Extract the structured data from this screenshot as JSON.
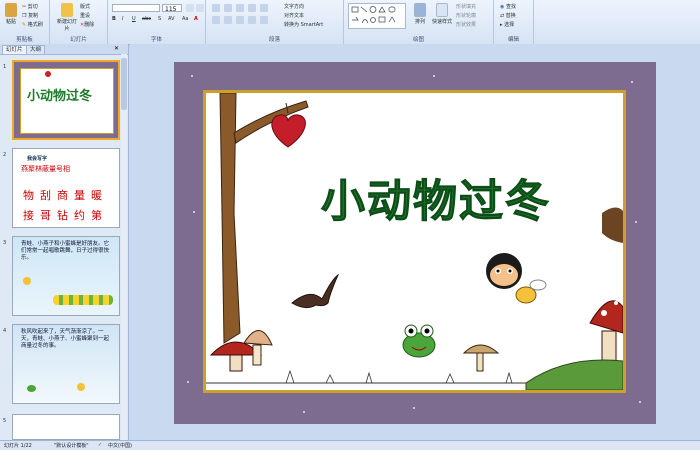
{
  "ribbon": {
    "clipboard": {
      "paste": "粘贴",
      "cut": "剪切",
      "copy": "复制",
      "format_painter": "格式刷",
      "label": "剪贴板"
    },
    "slides": {
      "new_slide": "新建幻灯片",
      "layout": "版式",
      "reset": "重设",
      "delete": "删除",
      "label": "幻灯片"
    },
    "font": {
      "size": "115",
      "label": "字体"
    },
    "paragraph": {
      "text_direction": "文字方向",
      "align_text": "对齐文本",
      "smartart": "转换为 SmartArt",
      "label": "段落"
    },
    "drawing": {
      "arrange": "排列",
      "quick_styles": "快速样式",
      "fill": "形状填充",
      "outline": "形状轮廓",
      "effects": "形状效果",
      "label": "绘图"
    },
    "editing": {
      "find": "查找",
      "replace": "替换",
      "select": "选择",
      "label": "编辑"
    }
  },
  "panel": {
    "tabs": [
      "幻灯片",
      "大纲"
    ],
    "slide_numbers": [
      "1",
      "2",
      "3",
      "4",
      "5"
    ],
    "thumb2": {
      "heading": "我会写字",
      "row1": [
        "燕",
        "聚",
        "林",
        "蔽",
        "量",
        "号",
        "相"
      ],
      "row2": [
        "物",
        "刮",
        "商",
        "量",
        "暖"
      ],
      "row3": [
        "接",
        "哥",
        "钻",
        "约",
        "第"
      ]
    },
    "thumb3": {
      "text": "青蛙、小燕子和小蜜蜂是好朋友。它们常常一起唱歌跳舞，日子过得很快乐。"
    },
    "thumb4": {
      "text": "秋风吹起来了，天气渐渐凉了。一天，青蛙、小燕子、小蜜蜂聚到一起商量过冬的事。"
    }
  },
  "slide": {
    "title": "小动物过冬"
  },
  "status": {
    "slide_info": "幻灯片 1/22",
    "theme": "\"默认设计模板\"",
    "language": "中文(中国)"
  },
  "colors": {
    "title_green": "#1f7a2b",
    "frame_purple": "#7d6c8f",
    "frame_gold": "#c9a227",
    "selection": "#f5a623"
  }
}
